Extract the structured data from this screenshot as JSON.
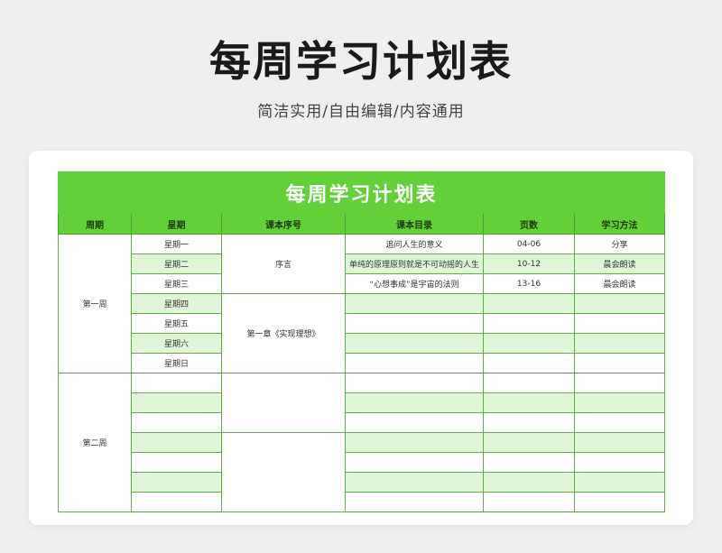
{
  "page": {
    "title": "每周学习计划表",
    "subtitle": "简洁实用/自由编辑/内容通用"
  },
  "table": {
    "title": "每周学习计划表",
    "headers": [
      "周期",
      "星期",
      "课本序号",
      "课本目录",
      "页数",
      "学习方法"
    ],
    "week1": {
      "label": "第一周",
      "days": [
        "星期一",
        "星期二",
        "星期三",
        "星期四",
        "星期五",
        "星期六",
        "星期日"
      ],
      "sections": [
        "序言",
        "第一章《实现理想》"
      ],
      "rows": [
        {
          "catalog": "追问人生的意义",
          "pages": "04-06",
          "method": "分享"
        },
        {
          "catalog": "单纯的原理原则就是不可动摇的人生",
          "pages": "10-12",
          "method": "晨会朗读"
        },
        {
          "catalog": "“心想事成”是宇宙的法则",
          "pages": "13-16",
          "method": "晨会朗读"
        }
      ]
    },
    "week2": {
      "label": "第二周"
    },
    "colors": {
      "header_green": "#63cf39",
      "alt_row": "#e1f5d8",
      "border": "#5ab045"
    }
  }
}
